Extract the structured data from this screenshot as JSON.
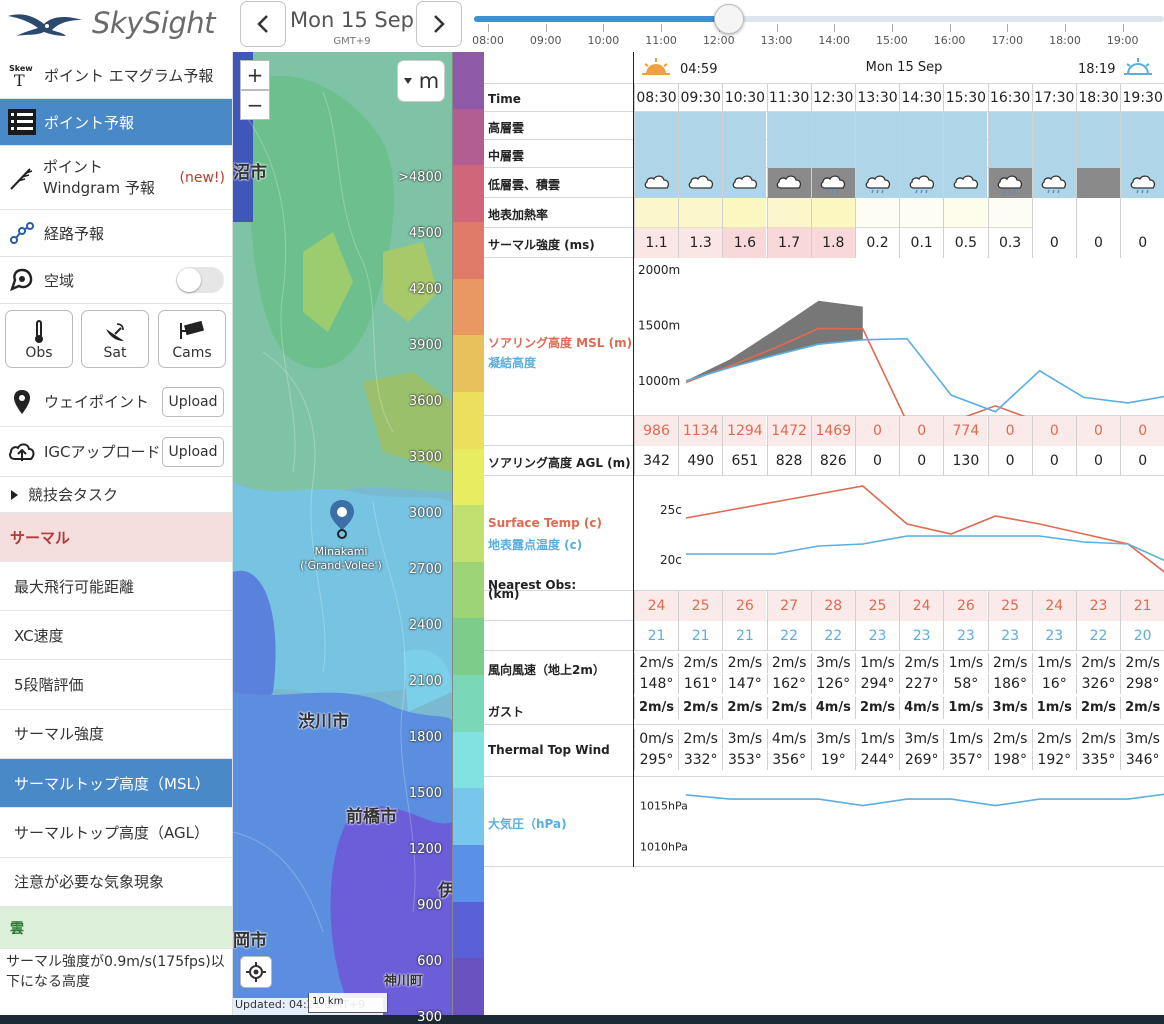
{
  "header": {
    "app_name": "SkySight",
    "date": "Mon 15 Sep",
    "timezone": "GMT+9",
    "timeline_ticks": [
      "08:00",
      "09:00",
      "10:00",
      "11:00",
      "12:00",
      "13:00",
      "14:00",
      "15:00",
      "16:00",
      "17:00",
      "18:00",
      "19:00"
    ],
    "timeline_position": 0.37
  },
  "sidebar": {
    "items": [
      {
        "label": "ポイント エマグラム予報",
        "icon": "skewt-icon"
      },
      {
        "label": "ポイント予報",
        "icon": "list-icon",
        "active": true
      },
      {
        "label": "ポイント Windgram 予報",
        "badge": "(new!)",
        "icon": "windgram-icon"
      },
      {
        "label": "経路予報",
        "icon": "route-icon"
      },
      {
        "label": "空域",
        "icon": "airspace-icon",
        "toggle": false
      }
    ],
    "obs_buttons": [
      "Obs",
      "Sat",
      "Cams"
    ],
    "waypoint_label": "ウェイポイント",
    "igc_label": "IGCアップロード",
    "upload_label": "Upload",
    "task_label": "競技会タスク",
    "section_thermal": "サーマル",
    "thermal_items": [
      "最大飛行可能距離",
      "XC速度",
      "5段階評価",
      "サーマル強度",
      "サーマルトップ高度（MSL）",
      "サーマルトップ高度（AGL）",
      "注意が必要な気象現象"
    ],
    "active_thermal_index": 4,
    "section_cloud": "雲",
    "cloud_desc": "サーマル強度が0.9m/s(175fps)以下になる高度"
  },
  "map": {
    "unit": "m",
    "zoom_in": "+",
    "zoom_out": "−",
    "cities": [
      "沼市",
      "渋川市",
      "前橋市",
      "岡市",
      "神川町",
      "伊"
    ],
    "marker_label_1": "Minakami",
    "marker_label_2": "('Grand-Volee')",
    "updated": "Updated: 04:21 GMT+9",
    "scale": "10 km",
    "legend_labels": [
      ">4800",
      "4500",
      "4200",
      "3900",
      "3600",
      "3300",
      "3000",
      "2700",
      "2400",
      "2100",
      "1800",
      "1500",
      "1200",
      "900",
      "600",
      "300"
    ],
    "legend_colors": [
      "#8e5aa8",
      "#b25e92",
      "#d0667a",
      "#e07a68",
      "#e89860",
      "#e8c05c",
      "#ecdf5c",
      "#e8ec60",
      "#c2e070",
      "#9ed478",
      "#7ecc8a",
      "#7ad8b8",
      "#82e2e2",
      "#78c6ec",
      "#5a90e8",
      "#5a60d8",
      "#6a52c0"
    ]
  },
  "forecast": {
    "sunrise": "04:59",
    "date": "Mon 15 Sep",
    "sunset": "18:19",
    "time_label": "Time",
    "times": [
      "08:30",
      "09:30",
      "10:30",
      "11:30",
      "12:30",
      "13:30",
      "14:30",
      "15:30",
      "16:30",
      "17:30",
      "18:30",
      "19:30"
    ],
    "labels": {
      "high_cloud": "高層雲",
      "mid_cloud": "中層雲",
      "low_cloud": "低層雲、積雲",
      "surface_heating": "地表加熱率",
      "thermal_strength": "サーマル強度 (ms)",
      "soaring_msl": "ソアリング高度 MSL (m)",
      "condensation": "凝結高度",
      "soaring_agl": "ソアリング高度 AGL (m)",
      "surface_temp": "Surface Temp (c)",
      "dewpoint": "地表露点温度 (c)",
      "nearest_obs_1": "Nearest Obs:",
      "nearest_obs_2": "(km)",
      "wind": "風向風速（地上2m）",
      "gust": "ガスト",
      "thermal_top_wind": "Thermal Top Wind",
      "pressure": "大気圧（hPa)"
    },
    "thermal_strength": [
      "1.1",
      "1.3",
      "1.6",
      "1.7",
      "1.8",
      "0.2",
      "0.1",
      "0.5",
      "0.3",
      "0",
      "0",
      "0"
    ],
    "soaring_msl": [
      "986",
      "1134",
      "1294",
      "1472",
      "1469",
      "0",
      "0",
      "774",
      "0",
      "0",
      "0",
      "0"
    ],
    "soaring_agl": [
      "342",
      "490",
      "651",
      "828",
      "826",
      "0",
      "0",
      "130",
      "0",
      "0",
      "0",
      "0"
    ],
    "obs_temp": [
      "24",
      "25",
      "26",
      "27",
      "28",
      "25",
      "24",
      "26",
      "25",
      "24",
      "23",
      "21"
    ],
    "obs_dew": [
      "21",
      "21",
      "21",
      "22",
      "22",
      "23",
      "23",
      "23",
      "23",
      "23",
      "22",
      "20"
    ],
    "wind_speed": [
      "2m/s",
      "2m/s",
      "2m/s",
      "2m/s",
      "3m/s",
      "1m/s",
      "2m/s",
      "1m/s",
      "2m/s",
      "1m/s",
      "2m/s",
      "2m/s"
    ],
    "wind_dir": [
      "148°",
      "161°",
      "147°",
      "162°",
      "126°",
      "294°",
      "227°",
      "58°",
      "186°",
      "16°",
      "326°",
      "298°"
    ],
    "gust": [
      "2m/s",
      "2m/s",
      "2m/s",
      "2m/s",
      "4m/s",
      "2m/s",
      "4m/s",
      "1m/s",
      "3m/s",
      "1m/s",
      "2m/s",
      "2m/s"
    ],
    "tt_wind_speed": [
      "0m/s",
      "2m/s",
      "3m/s",
      "4m/s",
      "3m/s",
      "1m/s",
      "3m/s",
      "1m/s",
      "2m/s",
      "2m/s",
      "2m/s",
      "3m/s"
    ],
    "tt_wind_dir": [
      "295°",
      "332°",
      "353°",
      "356°",
      "19°",
      "244°",
      "269°",
      "357°",
      "198°",
      "192°",
      "335°",
      "346°"
    ],
    "msl_chart_labels": [
      "2000m",
      "1500m",
      "1000m"
    ],
    "temp_chart_labels": [
      "25c",
      "20c"
    ],
    "pressure_labels": [
      "1015hPa",
      "1010hPa"
    ],
    "heating_shade": [
      0.5,
      0.5,
      0.6,
      0.5,
      0.6,
      0.1,
      0.1,
      0.2,
      0.1,
      0,
      0,
      0
    ],
    "low_cloud_dark": [
      false,
      false,
      false,
      true,
      true,
      false,
      false,
      false,
      true,
      false,
      true,
      false
    ],
    "cloud_rain": [
      false,
      false,
      false,
      false,
      true,
      true,
      true,
      false,
      true,
      true,
      false,
      true
    ]
  },
  "chart_data": [
    {
      "type": "line",
      "title": "",
      "ylabel": "",
      "x": [
        "08:30",
        "09:30",
        "10:30",
        "11:30",
        "12:30",
        "13:30",
        "14:30",
        "15:30",
        "16:30",
        "17:30",
        "18:30",
        "19:30"
      ],
      "ylim": [
        700,
        2000
      ],
      "series": [
        {
          "name": "ソアリング高度 MSL (m)",
          "color": "#e06a50",
          "values": [
            986,
            1134,
            1294,
            1472,
            1469,
            0,
            0,
            774,
            0,
            0,
            0,
            0
          ]
        },
        {
          "name": "凝結高度",
          "color": "#5aaee0",
          "values": [
            1000,
            1120,
            1230,
            1330,
            1370,
            1380,
            870,
            720,
            1090,
            850,
            800,
            870
          ]
        }
      ]
    },
    {
      "type": "line",
      "title": "",
      "ylabel": "",
      "x": [
        "08:30",
        "09:30",
        "10:30",
        "11:30",
        "12:30",
        "13:30",
        "14:30",
        "15:30",
        "16:30",
        "17:30",
        "18:30",
        "19:30"
      ],
      "ylim": [
        17,
        28
      ],
      "series": [
        {
          "name": "Surface Temp (c)",
          "color": "#e06a50",
          "values": [
            24.2,
            25.0,
            25.8,
            26.6,
            27.4,
            23.6,
            22.6,
            24.4,
            23.6,
            22.6,
            21.6,
            18.2
          ]
        },
        {
          "name": "地表露点温度 (c)",
          "color": "#5aaee0",
          "values": [
            20.6,
            20.6,
            20.6,
            21.4,
            21.6,
            22.4,
            22.4,
            22.4,
            22.4,
            21.8,
            21.6,
            19.6
          ]
        }
      ]
    },
    {
      "type": "line",
      "title": "",
      "ylabel": "",
      "x": [
        "08:30",
        "09:30",
        "10:30",
        "11:30",
        "12:30",
        "13:30",
        "14:30",
        "15:30",
        "16:30",
        "17:30",
        "18:30",
        "19:30"
      ],
      "ylim": [
        1008,
        1018
      ],
      "series": [
        {
          "name": "大気圧（hPa)",
          "color": "#5aaee0",
          "values": [
            1016.3,
            1015.8,
            1015.8,
            1015.8,
            1015.0,
            1015.8,
            1015.8,
            1015.0,
            1015.8,
            1015.8,
            1015.8,
            1016.5
          ]
        }
      ]
    }
  ]
}
